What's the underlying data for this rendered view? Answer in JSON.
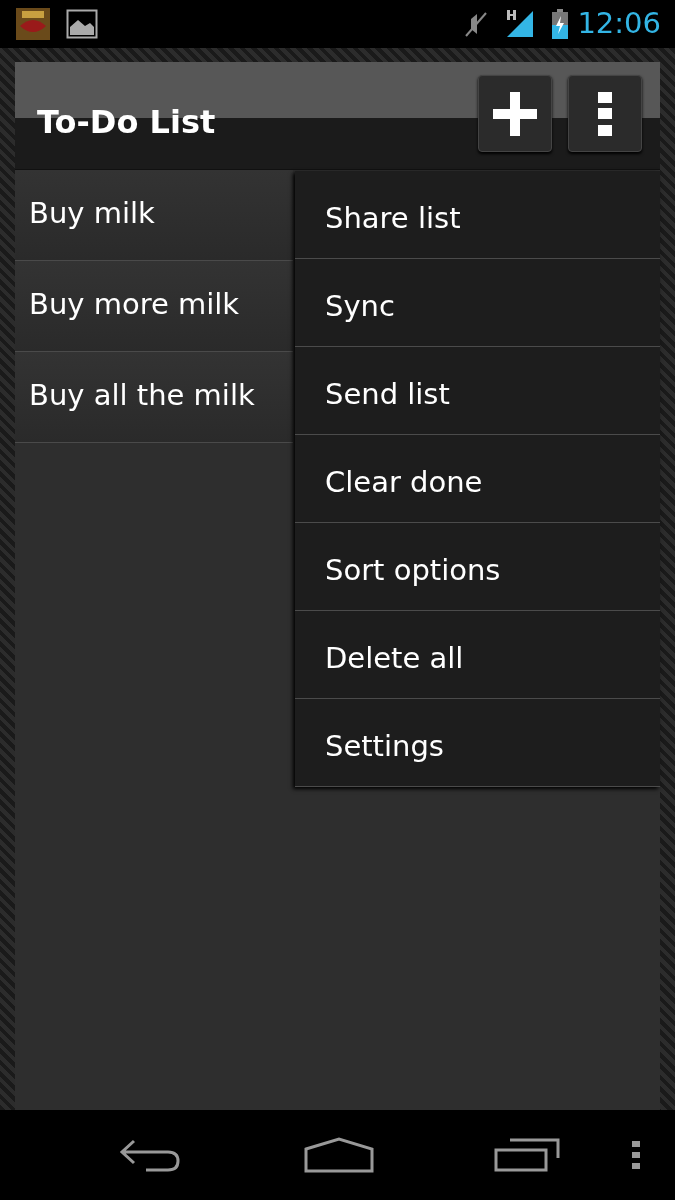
{
  "status_bar": {
    "time": "12:06"
  },
  "action_bar": {
    "title": "To-Do List"
  },
  "items": [
    {
      "label": "Buy milk"
    },
    {
      "label": "Buy more milk"
    },
    {
      "label": "Buy all the milk"
    }
  ],
  "menu": [
    {
      "label": "Share list"
    },
    {
      "label": "Sync"
    },
    {
      "label": "Send list"
    },
    {
      "label": "Clear done"
    },
    {
      "label": "Sort options"
    },
    {
      "label": "Delete all"
    },
    {
      "label": "Settings"
    }
  ]
}
